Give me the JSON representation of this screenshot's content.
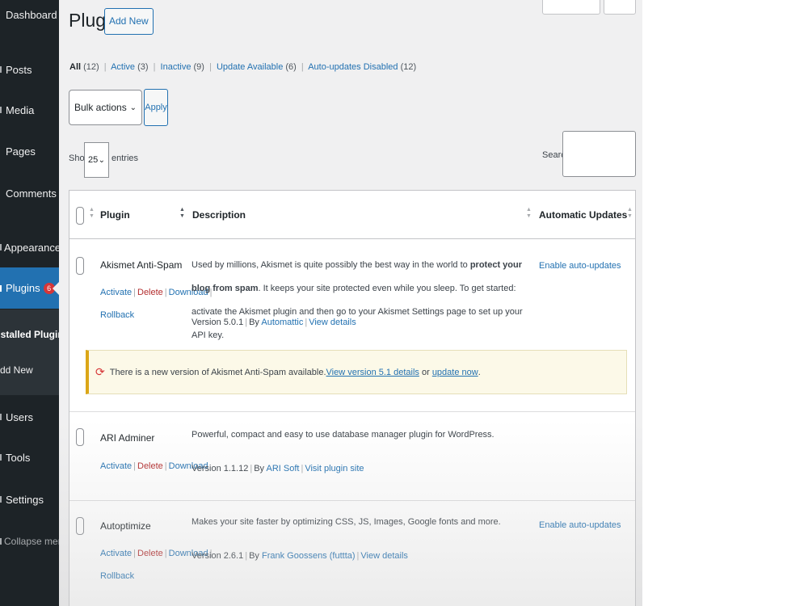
{
  "sidebar": {
    "dashboard": "Dashboard",
    "posts": "Posts",
    "media": "Media",
    "pages": "Pages",
    "comments": "Comments",
    "appearance": "Appearance",
    "plugins": "Plugins",
    "plugins_badge": "6",
    "submenu_installed": "Installed Plugins",
    "submenu_add_new": "Add New",
    "users": "Users",
    "tools": "Tools",
    "settings": "Settings",
    "collapse": "Collapse menu"
  },
  "header": {
    "title": "Plugins",
    "add_new": "Add New"
  },
  "filters": {
    "all": "All",
    "all_count": "(12)",
    "active": "Active",
    "active_count": "(3)",
    "inactive": "Inactive",
    "inactive_count": "(9)",
    "update_available": "Update Available",
    "update_available_count": "(6)",
    "auto_updates_disabled": "Auto-updates Disabled",
    "auto_updates_disabled_count": "(12)"
  },
  "bulk": {
    "selected": "Bulk actions",
    "apply": "Apply"
  },
  "entries": {
    "show": "Show",
    "value": "25",
    "entries": "entries",
    "search_label": "Search:"
  },
  "table": {
    "col_plugin": "Plugin",
    "col_description": "Description",
    "col_auto_updates": "Automatic Updates",
    "action_activate": "Activate",
    "action_delete": "Delete",
    "action_download": "Download",
    "action_rollback": "Rollback",
    "rows": [
      {
        "name": "Akismet Anti-Spam",
        "desc_a": "Used by millions, Akismet is quite possibly the best way in the world to ",
        "desc_bold": "protect your blog from spam",
        "desc_b": ". It keeps your site protected even while you sleep. To get started: activate the Akismet plugin and then go to your Akismet Settings page to set up your API key.",
        "version": "Version 5.0.1",
        "by": "By",
        "author": "Automattic",
        "details": "View details",
        "auto_updates": "Enable auto-updates"
      },
      {
        "name": "ARI Adminer",
        "desc": "Powerful, compact and easy to use database manager plugin for WordPress.",
        "version": "Version 1.1.12",
        "by": "By",
        "author": "ARI Soft",
        "details": "Visit plugin site"
      },
      {
        "name": "Autoptimize",
        "desc": "Makes your site faster by optimizing CSS, JS, Images, Google fonts and more.",
        "version": "Version 2.6.1",
        "by": "By",
        "author": "Frank Goossens (futtta)",
        "details": "View details",
        "auto_updates": "Enable auto-updates"
      }
    ],
    "notice": {
      "text": "There is a new version of Akismet Anti-Spam available. ",
      "link1": "View version 5.1 details",
      "or": " or ",
      "link2": "update now",
      "end": "."
    }
  },
  "colors": {
    "sidebar_bg": "#1d2327",
    "accent": "#2271b1",
    "badge": "#d63638",
    "notice_border": "#dba617"
  }
}
